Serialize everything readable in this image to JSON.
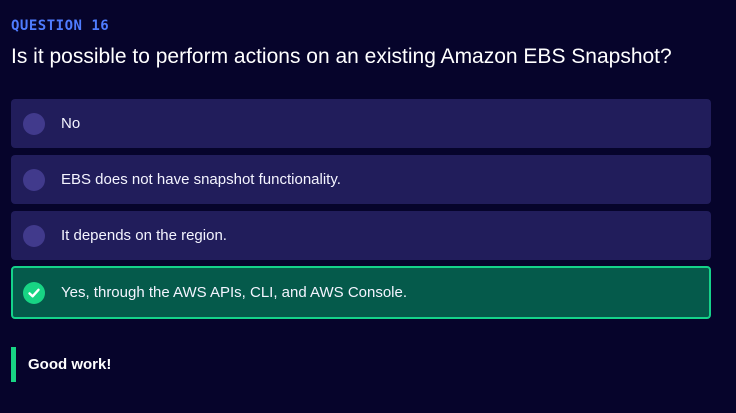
{
  "question": {
    "number_label": "QUESTION 16",
    "text": "Is it possible to perform actions on an existing Amazon EBS Snapshot?"
  },
  "options": [
    {
      "label": "No",
      "state": "unselected"
    },
    {
      "label": "EBS does not have snapshot functionality.",
      "state": "unselected"
    },
    {
      "label": "It depends on the region.",
      "state": "unselected"
    },
    {
      "label": "Yes, through the AWS APIs, CLI, and AWS Console.",
      "state": "correct",
      "icon": "check-icon"
    }
  ],
  "feedback": {
    "text": "Good work!"
  },
  "colors": {
    "background": "#06042b",
    "accent_blue": "#4f7cff",
    "option_bg": "#211d5b",
    "radio": "#413a8c",
    "correct_bg": "#055a4b",
    "correct_border": "#15d28a",
    "success": "#18d484"
  }
}
